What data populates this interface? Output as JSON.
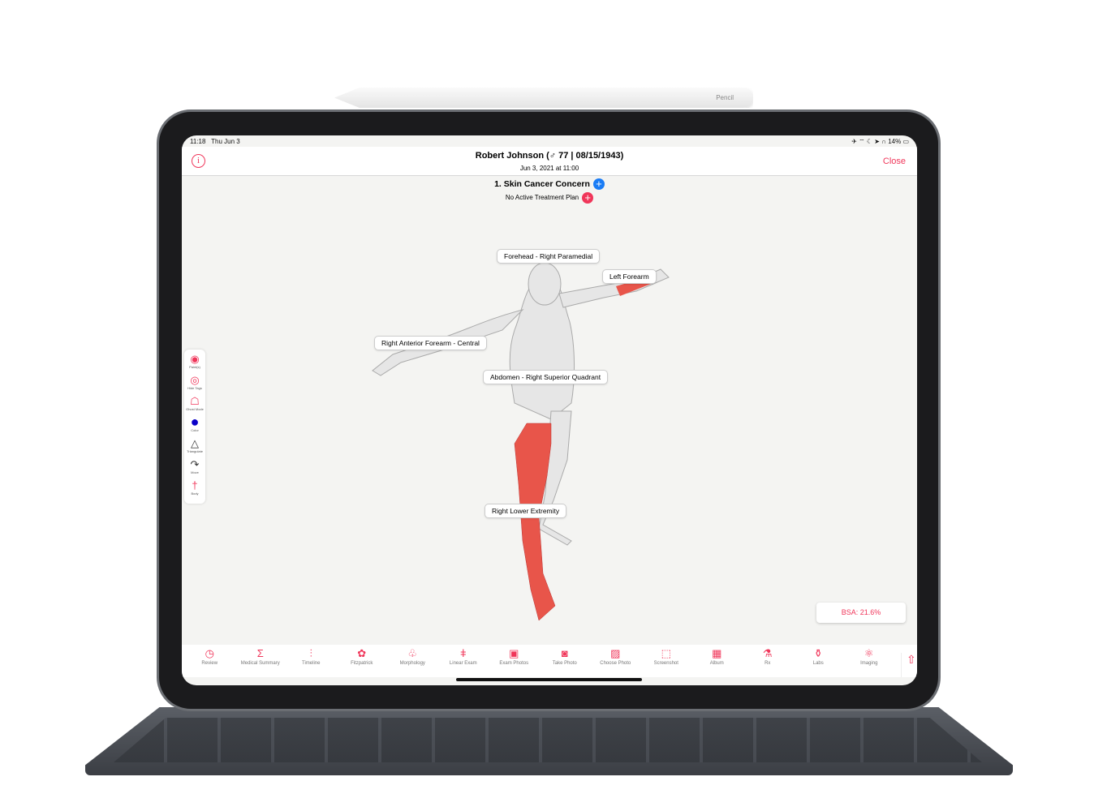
{
  "status_bar": {
    "time": "11:18",
    "date": "Thu Jun 3",
    "icons": "✈ ⌔ ☾ ➤ ∩",
    "battery": "14%"
  },
  "header": {
    "patient": "Robert Johnson (♂ 77 | 08/15/1943)",
    "visit_date": "Jun 3, 2021 at 11:00",
    "close_label": "Close",
    "info_icon": "i"
  },
  "concern": {
    "title": "1. Skin Cancer Concern",
    "plan": "No Active Treatment Plan"
  },
  "tags": [
    "Forehead - Right Paramedial",
    "Left Forearm",
    "Right Anterior Forearm - Central",
    "Abdomen - Right Superior Quadrant",
    "Right Lower Extremity"
  ],
  "tools": [
    {
      "label": "Paint(s)",
      "icon": "◉"
    },
    {
      "label": "Hide Tags",
      "icon": "◎"
    },
    {
      "label": "Ghost Mode",
      "icon": "☖"
    },
    {
      "label": "Color",
      "icon": "●"
    },
    {
      "label": "Triangulate",
      "icon": "△"
    },
    {
      "label": "Move",
      "icon": "↷"
    },
    {
      "label": "Body",
      "icon": "†"
    }
  ],
  "color_value": "#0a00c8",
  "accent": "#f0365a",
  "highlight": "#e8554a",
  "bsa": "BSA: 21.6%",
  "tabs": [
    {
      "label": "Review",
      "icon": "◷"
    },
    {
      "label": "Medical Summary",
      "icon": "Σ"
    },
    {
      "label": "Timeline",
      "icon": "⫶"
    },
    {
      "label": "Fitzpatrick",
      "icon": "✿"
    },
    {
      "label": "Morphology",
      "icon": "♧"
    },
    {
      "label": "Linear Exam",
      "icon": "ǂ"
    },
    {
      "label": "Exam Photos",
      "icon": "▣"
    },
    {
      "label": "Take Photo",
      "icon": "◙"
    },
    {
      "label": "Choose Photo",
      "icon": "▨"
    },
    {
      "label": "Screenshot",
      "icon": "⬚"
    },
    {
      "label": "Album",
      "icon": "▦"
    },
    {
      "label": "Rx",
      "icon": "⚗"
    },
    {
      "label": "Labs",
      "icon": "⚱"
    },
    {
      "label": "Imaging",
      "icon": "⚛"
    }
  ],
  "share_icon": "⇧",
  "pencil_brand": "Pencil"
}
